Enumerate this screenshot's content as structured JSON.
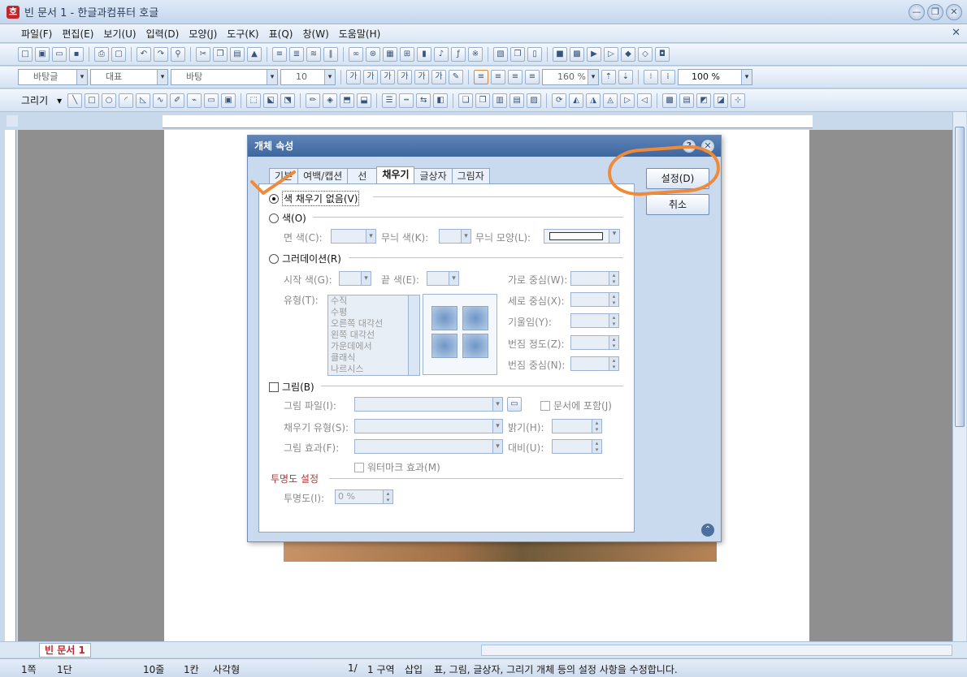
{
  "window": {
    "title": "빈 문서 1 - 한글과컴퓨터 호글",
    "app_icon": "호",
    "controls": [
      "—",
      "❐",
      "✕"
    ]
  },
  "menu": {
    "items": [
      "파일(F)",
      "편집(E)",
      "보기(U)",
      "입력(D)",
      "모양(J)",
      "도구(K)",
      "표(Q)",
      "창(W)",
      "도움말(H)"
    ],
    "close": "✕"
  },
  "format_toolbar": {
    "style": "바탕글",
    "representative": "대표",
    "font": "바탕",
    "font_size": "10",
    "char_spacing": "160 %",
    "zoom": "100 %"
  },
  "draw_toolbar": {
    "label": "그리기"
  },
  "dialog": {
    "title": "개체 속성",
    "help_icon": "?",
    "close_icon": "✕",
    "tabs": [
      "기본",
      "여백/캡션",
      "선",
      "채우기",
      "글상자",
      "그림자"
    ],
    "active_tab": "채우기",
    "ok": "설정(D)",
    "cancel": "취소",
    "fill": {
      "no_fill": "색 채우기 없음(V)",
      "color": "색(O)",
      "face_color": "면 색(C):",
      "pattern_color": "무늬 색(K):",
      "pattern_shape": "무늬 모양(L):",
      "gradation": "그러데이션(R)",
      "start_color": "시작 색(G):",
      "end_color": "끝 색(E):",
      "type": "유형(T):",
      "type_options": [
        "수직",
        "수평",
        "오른쪽 대각선",
        "왼쪽 대각선",
        "가운데에서",
        "클래식",
        "나르시스"
      ],
      "h_center": "가로 중심(W):",
      "v_center": "세로 중심(X):",
      "tilt": "기울임(Y):",
      "blur_degree": "번짐 정도(Z):",
      "blur_center": "번짐 중심(N):",
      "picture": "그림(B)",
      "picture_file": "그림 파일(I):",
      "embed": "문서에 포함(J)",
      "fill_type": "채우기 유형(S):",
      "brightness": "밝기(H):",
      "picture_effect": "그림 효과(F):",
      "contrast": "대비(U):",
      "watermark": "워터마크 효과(M)",
      "transparency_section": "투명도 설정",
      "transparency": "투명도(I):",
      "transparency_value": "0 %"
    }
  },
  "tabstrip": {
    "doc_tab": "빈 문서 1"
  },
  "status": {
    "page": "1쪽",
    "column": "1단",
    "line": "10줄",
    "col": "1칸",
    "object": "사각형",
    "pages": "1/",
    "section": "1 구역",
    "insert": "삽입",
    "message": "표, 그림, 글상자, 그리기 개체 등의 설정 사항을 수정합니다."
  },
  "colors": {
    "annotation": "#ef8a3a",
    "accent": "#3d679f",
    "tab_red": "#c0272d"
  }
}
